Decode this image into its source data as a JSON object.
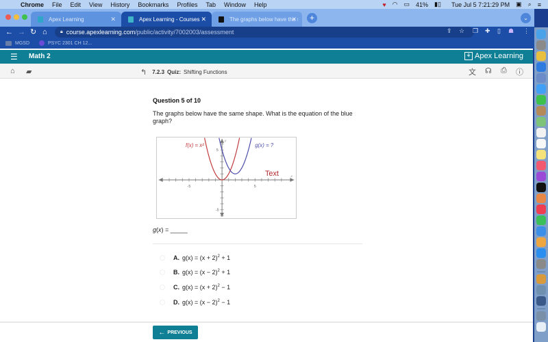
{
  "menubar": {
    "app": "Chrome",
    "items": [
      "File",
      "Edit",
      "View",
      "History",
      "Bookmarks",
      "Profiles",
      "Tab",
      "Window",
      "Help"
    ],
    "battery": "41%",
    "datetime": "Tue Jul 5  7:21:29 PM"
  },
  "tabs": [
    {
      "title": "Apex Learning",
      "active": false
    },
    {
      "title": "Apex Learning - Courses",
      "active": true
    },
    {
      "title": "The graphs below have the sa",
      "active": false
    }
  ],
  "address": {
    "domain": "course.apexlearning.com",
    "path": "/public/activity/7002003/assessment"
  },
  "bookmarks": [
    {
      "label": "MGSD",
      "icon": "folder-icon"
    },
    {
      "label": "PSYC 2301 CH 12...",
      "icon": "circle-icon"
    }
  ],
  "header": {
    "course": "Math 2",
    "brand": "Apex Learning"
  },
  "subbar": {
    "section": "7.2.3",
    "type": "Quiz:",
    "title": "Shifting Functions"
  },
  "question": {
    "number": "Question 5 of 10",
    "text": "The graphs below have the same shape. What is the equation of the blue graph?",
    "answer_prompt_fn": "g",
    "answer_prompt_var": "x",
    "answer_blank": " = _____",
    "choices": [
      {
        "letter": "A.",
        "lhs": "g(x) = (x + 2)",
        "exp": "2",
        "rhs": " + 1"
      },
      {
        "letter": "B.",
        "lhs": "g(x) = (x − 2)",
        "exp": "2",
        "rhs": " + 1"
      },
      {
        "letter": "C.",
        "lhs": "g(x) = (x + 2)",
        "exp": "2",
        "rhs": " − 1"
      },
      {
        "letter": "D.",
        "lhs": "g(x) = (x − 2)",
        "exp": "2",
        "rhs": " − 1"
      }
    ]
  },
  "buttons": {
    "previous": "PREVIOUS"
  },
  "chart_data": {
    "type": "line",
    "title": "",
    "xlabel": "x",
    "ylabel": "y",
    "xlim": [
      -10,
      10
    ],
    "ylim": [
      -7,
      7
    ],
    "xticks_labeled": [
      "-5",
      "5"
    ],
    "yticks_labeled": [
      "5",
      "-5"
    ],
    "series": [
      {
        "name": "f(x) = x²",
        "color": "#c0393b",
        "vertex": [
          0,
          0
        ],
        "formula": "x^2"
      },
      {
        "name": "g(x) = ?",
        "color": "#4a4aaa",
        "vertex": [
          2,
          1
        ],
        "formula": "(x-2)^2+1"
      }
    ],
    "annotations": [
      {
        "text": "f(x) = x²",
        "color": "#c0393b"
      },
      {
        "text": "g(x) = ?",
        "color": "#4a4aaa"
      },
      {
        "text": "Text",
        "color": "#b0262a"
      }
    ]
  }
}
